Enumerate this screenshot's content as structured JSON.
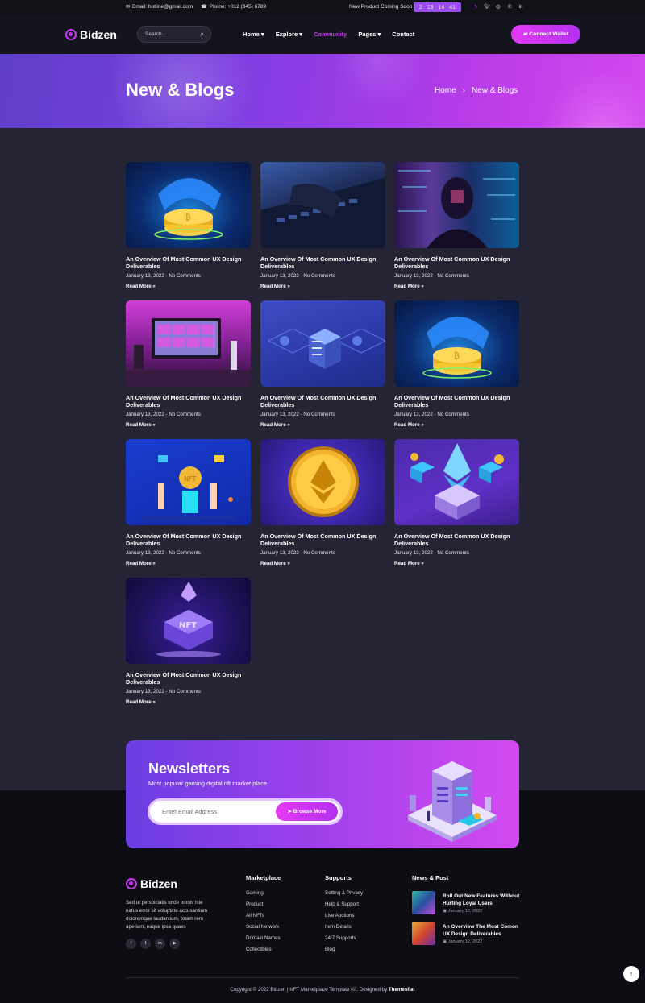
{
  "topbar": {
    "email_label": "Email: hotline@gmail.com",
    "phone_label": "Phone: +012 (345) 6789",
    "coming_soon": "New Product Coming Soon",
    "countdown": [
      "2",
      "13",
      "14",
      "41"
    ],
    "socials": [
      "twitch-icon",
      "twitter-icon",
      "instagram-icon",
      "pinterest-icon",
      "linkedin-icon"
    ]
  },
  "brand": {
    "name": "Bidzen",
    "accent": "#c739f0"
  },
  "header": {
    "search_placeholder": "Search...",
    "nav": [
      {
        "label": "Home",
        "has_dropdown": true
      },
      {
        "label": "Explore",
        "has_dropdown": true
      },
      {
        "label": "Community",
        "active": true
      },
      {
        "label": "Pages",
        "has_dropdown": true
      },
      {
        "label": "Contact"
      }
    ],
    "wallet_button": "Connect Wallet"
  },
  "hero": {
    "title": "New & Blogs",
    "breadcrumb": [
      "Home",
      "New & Blogs"
    ],
    "separator": "›"
  },
  "posts": [
    {
      "title": "An Overview Of Most Common UX Design Deliverables",
      "meta": "January 13, 2022 - No Comments",
      "more": "Read More »",
      "image": "coin-hand"
    },
    {
      "title": "An Overview Of Most Common UX Design Deliverables",
      "meta": "January 13, 2022 - No Comments",
      "more": "Read More »",
      "image": "keyboard"
    },
    {
      "title": "An Overview Of Most Common UX Design Deliverables",
      "meta": "January 13, 2022 - No Comments",
      "more": "Read More »",
      "image": "hacker"
    },
    {
      "title": "An Overview Of Most Common UX Design Deliverables",
      "meta": "January 13, 2022 - No Comments",
      "more": "Read More »",
      "image": "desk"
    },
    {
      "title": "An Overview Of Most Common UX Design Deliverables",
      "meta": "January 13, 2022 - No Comments",
      "more": "Read More »",
      "image": "isometric-blocks"
    },
    {
      "title": "An Overview Of Most Common UX Design Deliverables",
      "meta": "January 13, 2022 - No Comments",
      "more": "Read More »",
      "image": "coin-hand"
    },
    {
      "title": "An Overview Of Most Common UX Design Deliverables",
      "meta": "January 13, 2022 - No Comments",
      "more": "Read More »",
      "image": "nft-people"
    },
    {
      "title": "An Overview Of Most Common UX Design Deliverables",
      "meta": "January 13, 2022 - No Comments",
      "more": "Read More »",
      "image": "eth-coin"
    },
    {
      "title": "An Overview Of Most Common UX Design Deliverables",
      "meta": "January 13, 2022 - No Comments",
      "more": "Read More »",
      "image": "eth-isometric"
    },
    {
      "title": "An Overview Of Most Common UX Design Deliverables",
      "meta": "January 13, 2022 - No Comments",
      "more": "Read More »",
      "image": "nft-badge"
    }
  ],
  "newsletter": {
    "title": "Newsletters",
    "subtitle": "Most popular gaming digital nft market place",
    "placeholder": "Enter Email Address",
    "button": "Browse More"
  },
  "footer": {
    "about": "Sed ut perspiciatis unde omnis iste natus error sit voluptate accusantium doloremque laudantium, totam rem aperiam, eaque ipsa quaes",
    "social": [
      "facebook-icon",
      "twitter-icon",
      "linkedin-icon",
      "youtube-icon"
    ],
    "marketplace": {
      "title": "Marketplace",
      "items": [
        "Gaming",
        "Product",
        "All NFTs",
        "Social Network",
        "Domain Names",
        "Collectibles"
      ]
    },
    "supports": {
      "title": "Supports",
      "items": [
        "Setting & Privacy",
        "Help & Support",
        "Live Auctions",
        "Item Details",
        "24/7 Supports",
        "Blog"
      ]
    },
    "news": {
      "title": "News & Post",
      "posts": [
        {
          "title": "Roll Out New Features Without Hurting Loyal Users",
          "date": "January 12, 2022"
        },
        {
          "title": "An Overview The Most Comon UX Design Deliverables",
          "date": "January 12, 2022"
        }
      ]
    },
    "copyright_prefix": "Copyright © 2022 Bidzen | NFT Marketplace Template Kit. Designed by",
    "copyright_author": "Themesflat"
  }
}
